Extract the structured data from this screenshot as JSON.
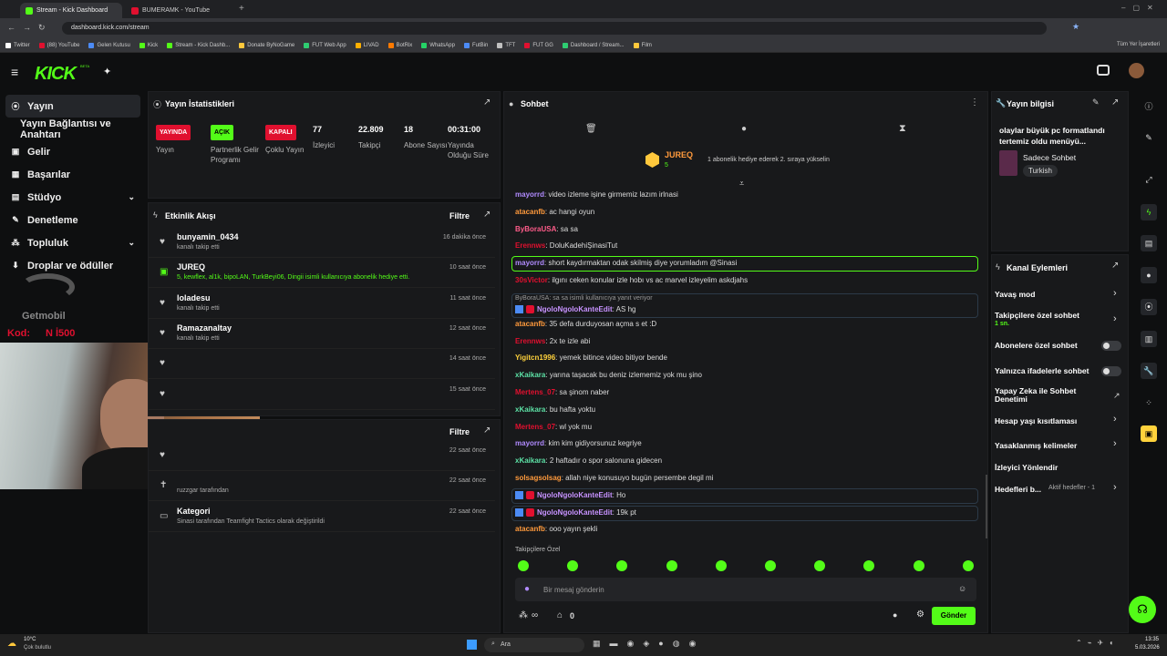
{
  "browser": {
    "tabs": [
      {
        "title": "Stream - Kick Dashboard",
        "icon": "kick-icon"
      },
      {
        "title": "BUMERAMK - YouTube",
        "icon": "youtube-icon"
      }
    ],
    "url": "dashboard.kick.com/stream",
    "bookmarks": [
      "Twitter",
      "(88) YouTube",
      "Gelen Kutusu",
      "Kick",
      "Stream - Kick Dashb...",
      "Donate ByNoGame",
      "FUT Web App",
      "LIVAD",
      "BotRix",
      "WhatsApp",
      "FutBin",
      "TFT",
      "FUT GG",
      "Dashboard / Stream...",
      "Film"
    ],
    "bookmarks_right": "Tüm Yer İşaretleri"
  },
  "brand": {
    "logo": "KICK",
    "beta": "BETA"
  },
  "nav": [
    {
      "label": "Yayın",
      "icon": "broadcast-icon"
    },
    {
      "label": "Yayın Bağlantısı ve Anahtarı",
      "icon": ""
    },
    {
      "label": "Gelir",
      "icon": "revenue-icon"
    },
    {
      "label": "Başarılar",
      "icon": "achievements-icon"
    },
    {
      "label": "Stüdyo",
      "icon": "studio-icon"
    },
    {
      "label": "Denetleme",
      "icon": "moderation-icon"
    },
    {
      "label": "Topluluk",
      "icon": "community-icon"
    },
    {
      "label": "Droplar ve ödüller",
      "icon": "drops-icon"
    }
  ],
  "overlay": {
    "sponsor": "Getmobil",
    "code_label": "Kod:",
    "code_value": "N İ500"
  },
  "stats": {
    "title": "Yayın İstatistikleri",
    "badges": [
      {
        "label": "YAYINDA",
        "caption": "Yayın",
        "color": "#e0102f"
      },
      {
        "label": "AÇIK",
        "caption": "Partnerlik Gelir Programı",
        "color": "#53fc18"
      },
      {
        "label": "KAPALI",
        "caption": "Çoklu Yayın",
        "color": "#e0102f"
      }
    ],
    "values": [
      {
        "value": "77",
        "caption": "İzleyici"
      },
      {
        "value": "22.809",
        "caption": "Takipçi"
      },
      {
        "value": "18",
        "caption": "Abone Sayısı"
      },
      {
        "value": "00:31:00",
        "caption": "Yayında Olduğu Süre"
      }
    ]
  },
  "activity": {
    "title": "Etkinlik Akışı",
    "filter": "Filtre",
    "items": [
      {
        "name": "bunyamin_0434",
        "sub": "kanalı takip etti",
        "time": "16 dakika önce"
      },
      {
        "name": "JUREQ",
        "sub": "5, kewflex, al1k, bipoLAN, TurkBeyi06, Dingii isimli kullanıcıya abonelik hediye etti.",
        "time": "10 saat önce"
      },
      {
        "name": "loladesu",
        "sub": "kanalı takip etti",
        "time": "11 saat önce"
      },
      {
        "name": "Ramazanaltay",
        "sub": "kanalı takip etti",
        "time": "12 saat önce"
      },
      {
        "name": "",
        "sub": "",
        "time": "14 saat önce"
      },
      {
        "name": "",
        "sub": "",
        "time": "15 saat önce"
      }
    ]
  },
  "activity2": {
    "filter": "Filtre",
    "items": [
      {
        "name": "",
        "sub": "",
        "time": "22 saat önce"
      },
      {
        "name": "",
        "sub": "ruzzgar tarafından",
        "time": "22 saat önce"
      },
      {
        "name": "Kategori",
        "sub": "Sinasi tarafından Teamfight Tactics olarak değiştirildi",
        "time": "22 saat önce"
      }
    ]
  },
  "chat": {
    "title": "Sohbet",
    "pinned_user": "JUREQ",
    "pinned_count": "5",
    "pinned_text": "1 abonelik hediye ederek 2. sıraya yükselin",
    "messages": [
      {
        "user": "mayorrd",
        "color": "#b18bff",
        "text": "video izleme işine girmemiz lazım irlnasi"
      },
      {
        "user": "atacanfb",
        "color": "#ff9a3c",
        "text": "ac hangi oyun"
      },
      {
        "user": "ByBoraUSA",
        "color": "#ff5c8a",
        "text": "sa sa"
      },
      {
        "user": "Erennws",
        "color": "#e0102f",
        "text": "DoluKadehiŞinasiTut"
      },
      {
        "user": "mayorrd",
        "color": "#b18bff",
        "text": "short kaydırmaktan odak skilmiş diye yorumladım @Sinasi"
      },
      {
        "user": "30sVictor",
        "color": "#e0102f",
        "text": "ilgını ceken konular izle hobı vs ac marvel izleyelim askdjahs"
      },
      {
        "user": "NgoloNgoloKanteEdit",
        "color": "#c792ff",
        "text": "AS hg",
        "reply": "ByBoraUSA: sa sa isimli kullanıcıya yanıt veriyor"
      },
      {
        "user": "atacanfb",
        "color": "#ff9a3c",
        "text": "35 defa durduyosan açma s et :D"
      },
      {
        "user": "Erennws",
        "color": "#e0102f",
        "text": "2x te izle abi"
      },
      {
        "user": "Yigitcn1996",
        "color": "#ffd23c",
        "text": "yemek bitince video bitiyor bende"
      },
      {
        "user": "xKaikara",
        "color": "#5ce0a5",
        "text": "yarına taşacak bu deniz izlememiz yok mu şino"
      },
      {
        "user": "Mertens_07",
        "color": "#e0102f",
        "text": "sa şinom naber"
      },
      {
        "user": "xKaikara",
        "color": "#5ce0a5",
        "text": "bu hafta yoktu"
      },
      {
        "user": "Mertens_07",
        "color": "#e0102f",
        "text": "wl yok mu"
      },
      {
        "user": "mayorrd",
        "color": "#b18bff",
        "text": "kim kim gidiyorsunuz kegriye"
      },
      {
        "user": "xKaikara",
        "color": "#5ce0a5",
        "text": "2 haftadır o spor salonuna gidecen"
      },
      {
        "user": "solsagsolsag",
        "color": "#ff9a3c",
        "text": "allah niye konusuyo bugün persembe degil mi"
      },
      {
        "user": "NgoloNgoloKanteEdit",
        "color": "#c792ff",
        "text": "Ho"
      },
      {
        "user": "NgoloNgoloKanteEdit",
        "color": "#c792ff",
        "text": "19k pt"
      },
      {
        "user": "atacanfb",
        "color": "#ff9a3c",
        "text": "ooo yayın şekli"
      }
    ],
    "followers_only": "Takipçilere Özel",
    "input_placeholder": "Bir mesaj gönderin",
    "points": "∞",
    "count": "0",
    "send": "Gönder"
  },
  "info": {
    "title": "Yayın bilgisi",
    "stream_title": "olaylar büyük pc formatlandı tertemiz oldu menüyü...",
    "chat_mode": "Sadece Sohbet",
    "language": "Turkish"
  },
  "channel": {
    "title": "Kanal Eylemleri",
    "slow_mode": "Yavaş mod",
    "followers_chat": "Takipçilere özel sohbet",
    "followers_chat_sub": "1 sn.",
    "subs_chat": "Abonelere özel sohbet",
    "emote_chat": "Yalnızca ifadelerle sohbet",
    "ai_mod": "Yapay Zeka ile Sohbet Denetimi",
    "age_restrict": "Hesap yaşı kısıtlaması",
    "banned_words": "Yasaklanmış kelimeler",
    "raid": "İzleyici Yönlendir",
    "goals": "Hedefleri b...",
    "goals_status": "Aktif hedefler - 1"
  },
  "taskbar": {
    "weather_temp": "10°C",
    "weather_desc": "Çok bulutlu",
    "search": "Ara",
    "time": "13:35",
    "date": "5.03.2026"
  }
}
